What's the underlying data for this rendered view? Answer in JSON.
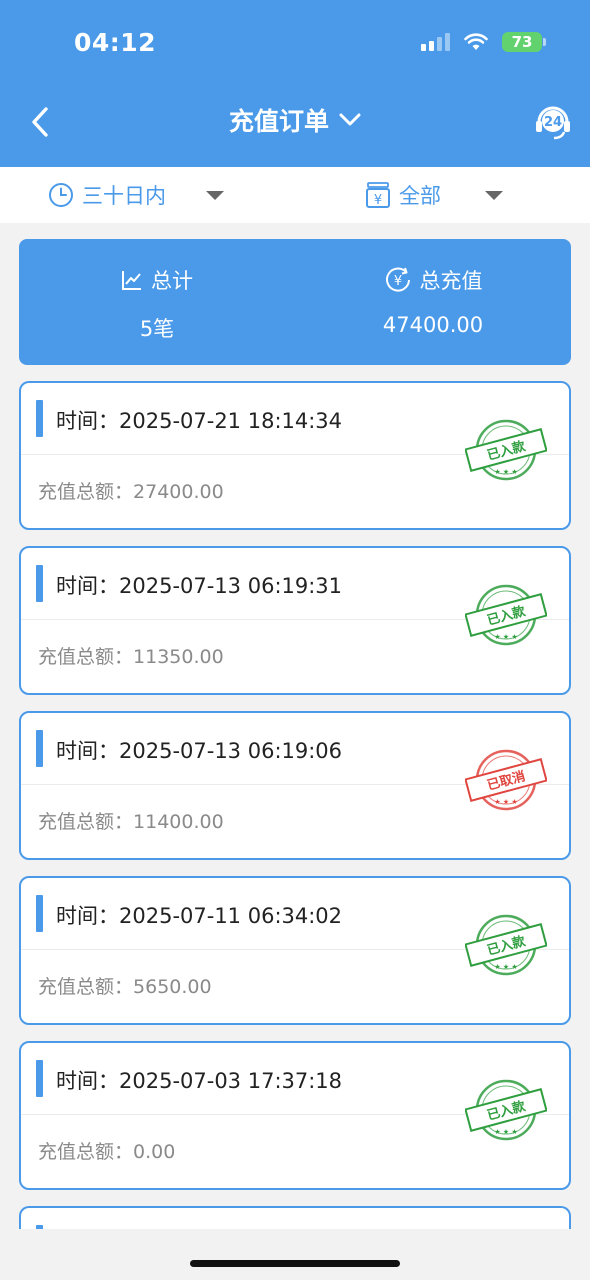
{
  "status_bar": {
    "time": "04:12",
    "battery": "73"
  },
  "header": {
    "title": "充值订单"
  },
  "filters": {
    "date_range": "三十日内",
    "type": "全部"
  },
  "summary": {
    "count_label": "总计",
    "count_value": "5笔",
    "total_label": "总充值",
    "total_value": "47400.00"
  },
  "orders": [
    {
      "time_label": "时间：",
      "time": "2025-07-21 18:14:34",
      "amount_label": "充值总额：",
      "amount": "27400.00",
      "status": "已入款",
      "status_color": "#2e9e3e"
    },
    {
      "time_label": "时间：",
      "time": "2025-07-13 06:19:31",
      "amount_label": "充值总额：",
      "amount": "11350.00",
      "status": "已入款",
      "status_color": "#2e9e3e"
    },
    {
      "time_label": "时间：",
      "time": "2025-07-13 06:19:06",
      "amount_label": "充值总额：",
      "amount": "11400.00",
      "status": "已取消",
      "status_color": "#e0463f"
    },
    {
      "time_label": "时间：",
      "time": "2025-07-11 06:34:02",
      "amount_label": "充值总额：",
      "amount": "5650.00",
      "status": "已入款",
      "status_color": "#2e9e3e"
    },
    {
      "time_label": "时间：",
      "time": "2025-07-03 17:37:18",
      "amount_label": "充值总额：",
      "amount": "0.00",
      "status": "已入款",
      "status_color": "#2e9e3e"
    }
  ],
  "colors": {
    "primary": "#4a9ae9",
    "success": "#2e9e3e",
    "cancelled": "#e0463f"
  },
  "icons": {
    "back": "chevron-left-icon",
    "title_dropdown": "chevron-down-icon",
    "support": "headset-24-icon",
    "date_filter": "clock-icon",
    "type_filter": "yen-wallet-icon",
    "count": "line-chart-icon",
    "total": "yen-coin-icon"
  }
}
